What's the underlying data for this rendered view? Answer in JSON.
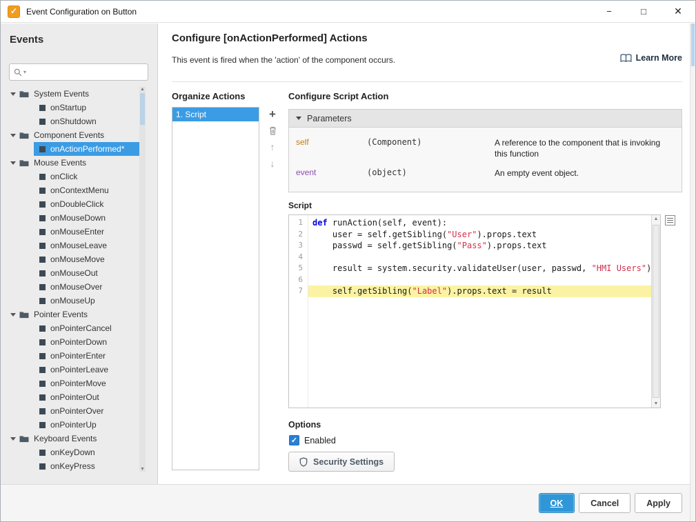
{
  "titlebar": {
    "title": "Event Configuration on Button",
    "minimize": "−",
    "maximize": "□",
    "close": "✕"
  },
  "sidebar": {
    "heading": "Events",
    "search": {
      "placeholder": ""
    },
    "tree": [
      {
        "kind": "folder",
        "label": "System Events",
        "expanded": true
      },
      {
        "kind": "leaf",
        "label": "onStartup"
      },
      {
        "kind": "leaf",
        "label": "onShutdown"
      },
      {
        "kind": "folder",
        "label": "Component Events",
        "expanded": true
      },
      {
        "kind": "leaf",
        "label": "onActionPerformed*",
        "selected": true
      },
      {
        "kind": "folder",
        "label": "Mouse Events",
        "expanded": true
      },
      {
        "kind": "leaf",
        "label": "onClick"
      },
      {
        "kind": "leaf",
        "label": "onContextMenu"
      },
      {
        "kind": "leaf",
        "label": "onDoubleClick"
      },
      {
        "kind": "leaf",
        "label": "onMouseDown"
      },
      {
        "kind": "leaf",
        "label": "onMouseEnter"
      },
      {
        "kind": "leaf",
        "label": "onMouseLeave"
      },
      {
        "kind": "leaf",
        "label": "onMouseMove"
      },
      {
        "kind": "leaf",
        "label": "onMouseOut"
      },
      {
        "kind": "leaf",
        "label": "onMouseOver"
      },
      {
        "kind": "leaf",
        "label": "onMouseUp"
      },
      {
        "kind": "folder",
        "label": "Pointer Events",
        "expanded": true
      },
      {
        "kind": "leaf",
        "label": "onPointerCancel"
      },
      {
        "kind": "leaf",
        "label": "onPointerDown"
      },
      {
        "kind": "leaf",
        "label": "onPointerEnter"
      },
      {
        "kind": "leaf",
        "label": "onPointerLeave"
      },
      {
        "kind": "leaf",
        "label": "onPointerMove"
      },
      {
        "kind": "leaf",
        "label": "onPointerOut"
      },
      {
        "kind": "leaf",
        "label": "onPointerOver"
      },
      {
        "kind": "leaf",
        "label": "onPointerUp"
      },
      {
        "kind": "folder",
        "label": "Keyboard Events",
        "expanded": true
      },
      {
        "kind": "leaf",
        "label": "onKeyDown"
      },
      {
        "kind": "leaf",
        "label": "onKeyPress"
      }
    ]
  },
  "main": {
    "title": "Configure [onActionPerformed] Actions",
    "subtitle": "This event is fired when the 'action' of the component occurs.",
    "learn_more": "Learn More",
    "organize_heading": "Organize Actions",
    "actions": [
      {
        "label": "1. Script",
        "selected": true
      }
    ],
    "script_heading": "Configure Script Action",
    "parameters": {
      "header": "Parameters",
      "rows": [
        {
          "name": "self",
          "type": "(Component)",
          "description": "A reference to the component that is invoking this function",
          "name_color": "#bf7e15"
        },
        {
          "name": "event",
          "type": "(object)",
          "description": "An empty event object.",
          "name_color": "#8a4fb0"
        }
      ]
    },
    "script_label": "Script",
    "code": [
      {
        "line": 1,
        "highlight": false,
        "tokens": [
          [
            "kw",
            "def"
          ],
          [
            "pl",
            " runAction(self, event):"
          ]
        ]
      },
      {
        "line": 2,
        "highlight": false,
        "tokens": [
          [
            "pl",
            "    user = self.getSibling("
          ],
          [
            "st",
            "\"User\""
          ],
          [
            "pl",
            ").props.text"
          ]
        ]
      },
      {
        "line": 3,
        "highlight": false,
        "tokens": [
          [
            "pl",
            "    passwd = self.getSibling("
          ],
          [
            "st",
            "\"Pass\""
          ],
          [
            "pl",
            ").props.text"
          ]
        ]
      },
      {
        "line": 4,
        "highlight": false,
        "tokens": []
      },
      {
        "line": 5,
        "highlight": false,
        "tokens": [
          [
            "pl",
            "    result = system.security.validateUser(user, passwd, "
          ],
          [
            "st",
            "\"HMI Users\""
          ],
          [
            "pl",
            ")"
          ]
        ]
      },
      {
        "line": 6,
        "highlight": false,
        "tokens": []
      },
      {
        "line": 7,
        "highlight": true,
        "tokens": [
          [
            "pl",
            "    self.getSibling("
          ],
          [
            "st",
            "\"Label\""
          ],
          [
            "pl",
            ").props.text = result"
          ]
        ]
      }
    ],
    "options_label": "Options",
    "enabled": {
      "label": "Enabled",
      "checked": true
    },
    "security_button": "Security Settings"
  },
  "footer": {
    "ok": "OK",
    "cancel": "Cancel",
    "apply": "Apply"
  },
  "colors": {
    "selection_blue": "#3b9ce4",
    "ok_button_blue": "#2f97d8",
    "keyword_blue": "#0000e0",
    "string_red": "#d12f4b",
    "line_highlight_yellow": "#fbf3a3",
    "checkbox_blue": "#2a7fd4",
    "titlebar_icon_orange": "#f29c1f"
  }
}
